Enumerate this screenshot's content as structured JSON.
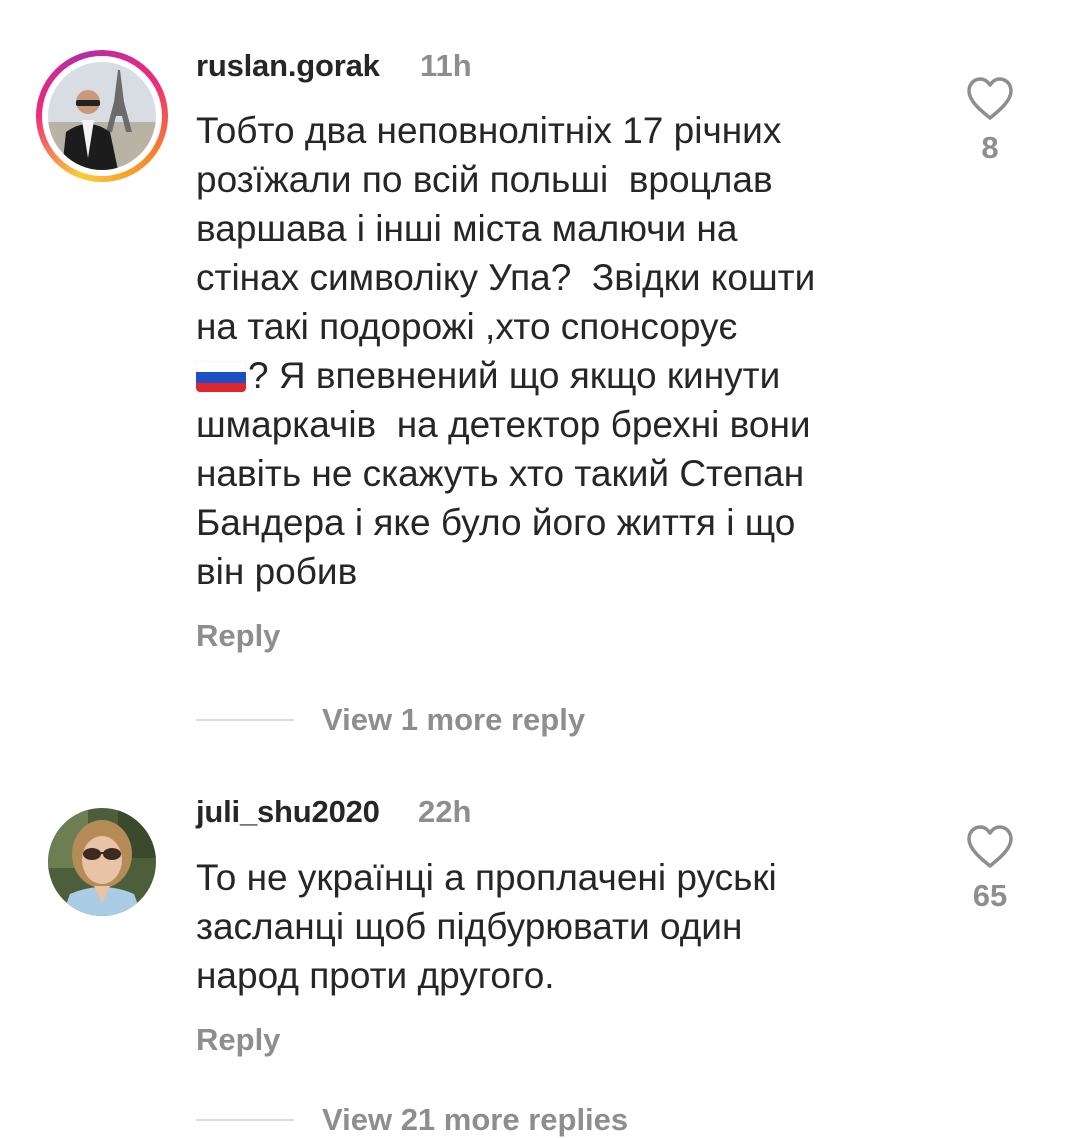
{
  "comments": [
    {
      "username": "ruslan.gorak",
      "time": "11h",
      "text_before_flag": "Тобто два неповнолітніх 17 річних\nрозїжали по всій польші  вроцлав\nваршава і інші міста малючи на\nстінах символіку Упа?  Звідки кошти\nна такі подорожі ,хто спонсорує\n",
      "flag_icon": "russia-flag-emoji",
      "text_after_flag": "? Я впевнений що якщо кинути\nшмаркачів  на детектор брехні вони\nнавіть не скажуть хто такий Степан\nБандера і яке було його життя і що\nвін робив",
      "likes": "8",
      "reply_label": "Reply",
      "view_replies_label": "View 1 more reply",
      "has_story_ring": true
    },
    {
      "username": "juli_shu2020",
      "time": "22h",
      "text": "То не українці а проплачені руські\nзасланці щоб підбурювати один\nнарод проти другого.",
      "likes": "65",
      "reply_label": "Reply",
      "view_replies_label": "View 21 more replies",
      "has_story_ring": false
    }
  ],
  "icons": {
    "like": "heart-outline-icon"
  },
  "colors": {
    "text": "#262626",
    "secondary": "#8e8e8e",
    "divider": "#dbdbdb"
  }
}
